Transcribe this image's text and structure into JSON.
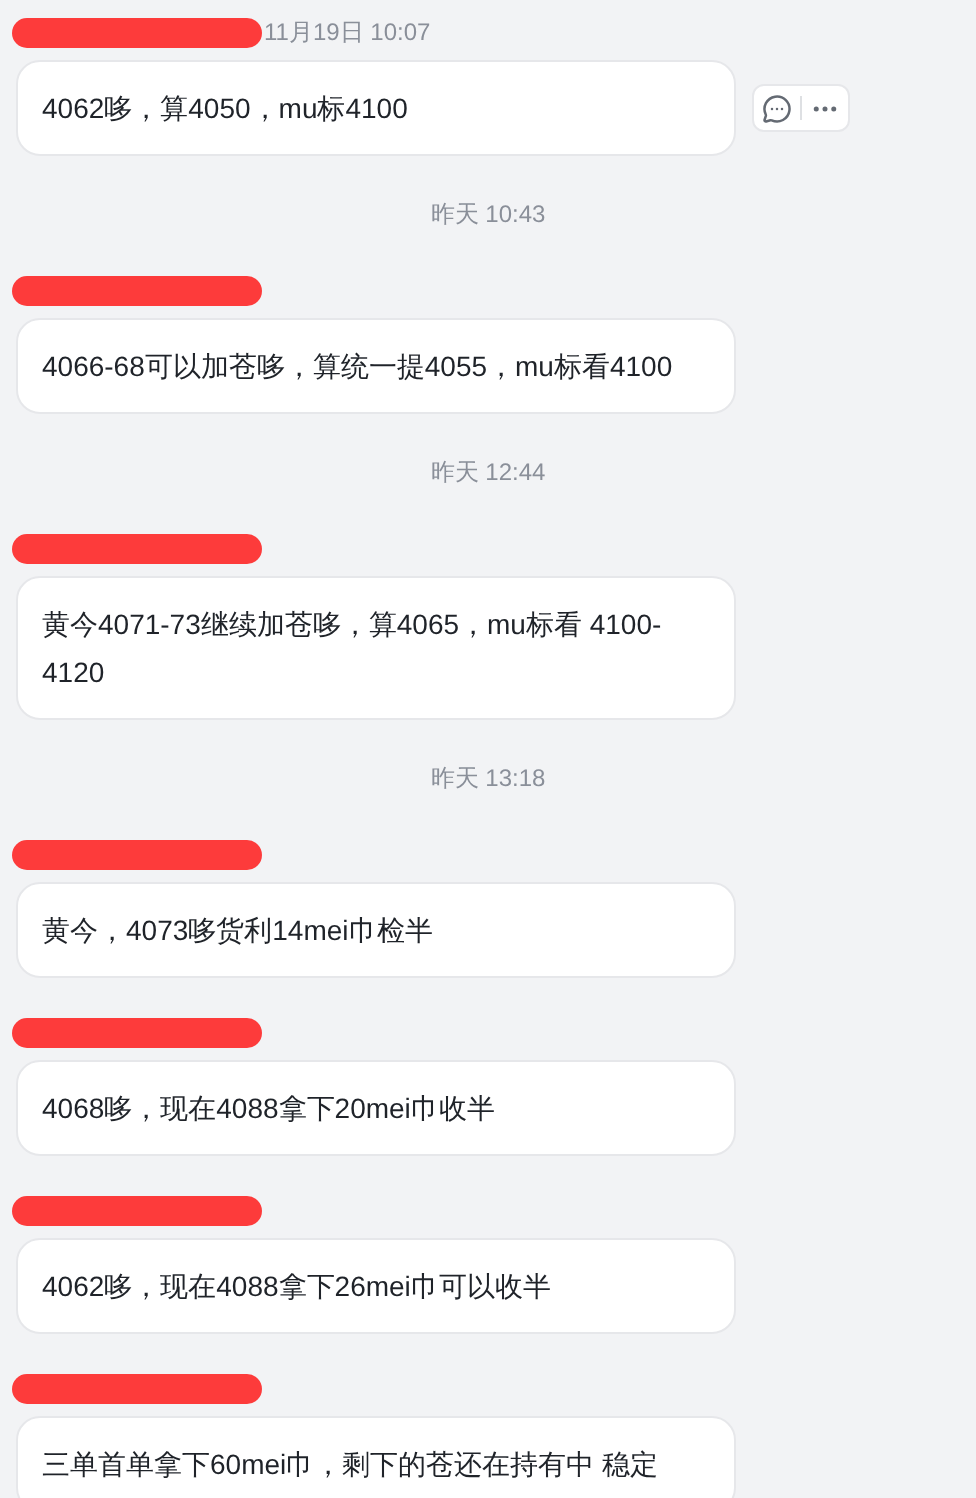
{
  "items": [
    {
      "kind": "message",
      "sender_redacted": true,
      "time": "11月19日 10:07",
      "text": "4062哆，算4050，mu标4100",
      "actions_shown": true
    },
    {
      "kind": "time",
      "text": "昨天 10:43"
    },
    {
      "kind": "message",
      "sender_redacted": true,
      "text": "4066-68可以加苍哆，算统一提4055，mu标看4100"
    },
    {
      "kind": "time",
      "text": "昨天 12:44"
    },
    {
      "kind": "message",
      "sender_redacted": true,
      "text": "黄今4071-73继续加苍哆，算4065，mu标看 4100-4120"
    },
    {
      "kind": "time",
      "text": "昨天 13:18"
    },
    {
      "kind": "message",
      "sender_redacted": true,
      "text": "黄今，4073哆货利14mei巾检半"
    },
    {
      "kind": "message",
      "sender_redacted": true,
      "text": "4068哆，现在4088拿下20mei巾收半"
    },
    {
      "kind": "message",
      "sender_redacted": true,
      "text": "4062哆，现在4088拿下26mei巾可以收半"
    },
    {
      "kind": "message",
      "sender_redacted": true,
      "text": "三单首单拿下60mei巾，剩下的苍还在持有中 稳定"
    }
  ]
}
